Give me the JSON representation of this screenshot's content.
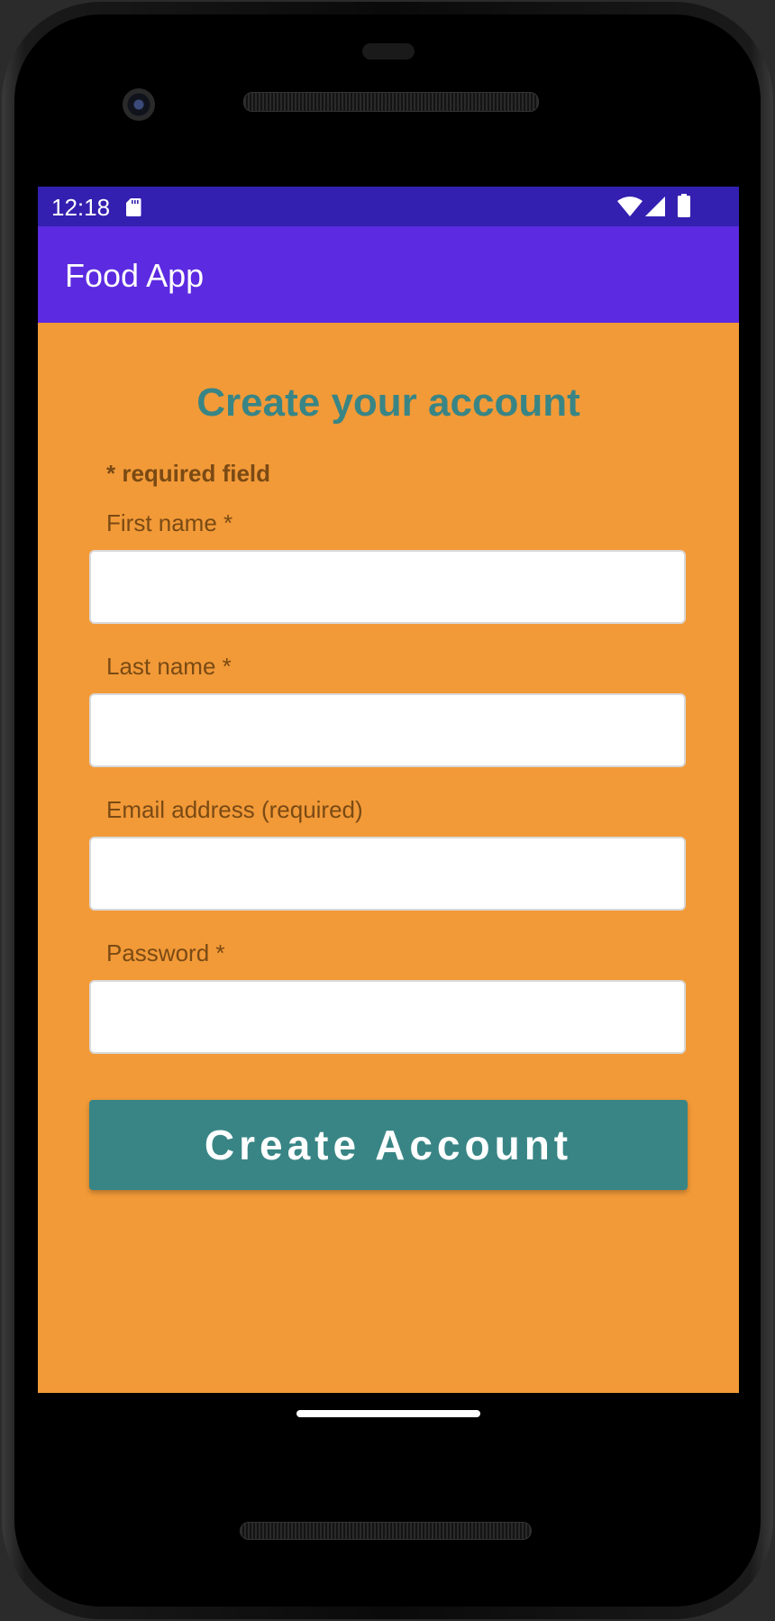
{
  "status_bar": {
    "time": "12:18",
    "color": "#3320b0"
  },
  "app_bar": {
    "title": "Food App",
    "color": "#5c2ae0"
  },
  "form": {
    "title": "Create your account",
    "required_note": "* required field",
    "fields": [
      {
        "label": "First name *",
        "value": ""
      },
      {
        "label": "Last name *",
        "value": ""
      },
      {
        "label": "Email address (required)",
        "value": ""
      },
      {
        "label": "Password *",
        "value": ""
      }
    ],
    "submit_label": "Create Account"
  },
  "colors": {
    "background": "#f29a38",
    "accent": "#398585",
    "label_text": "#7a4a14"
  },
  "icons": [
    "sd-card-icon",
    "wifi-icon",
    "cell-signal-icon",
    "battery-icon"
  ]
}
